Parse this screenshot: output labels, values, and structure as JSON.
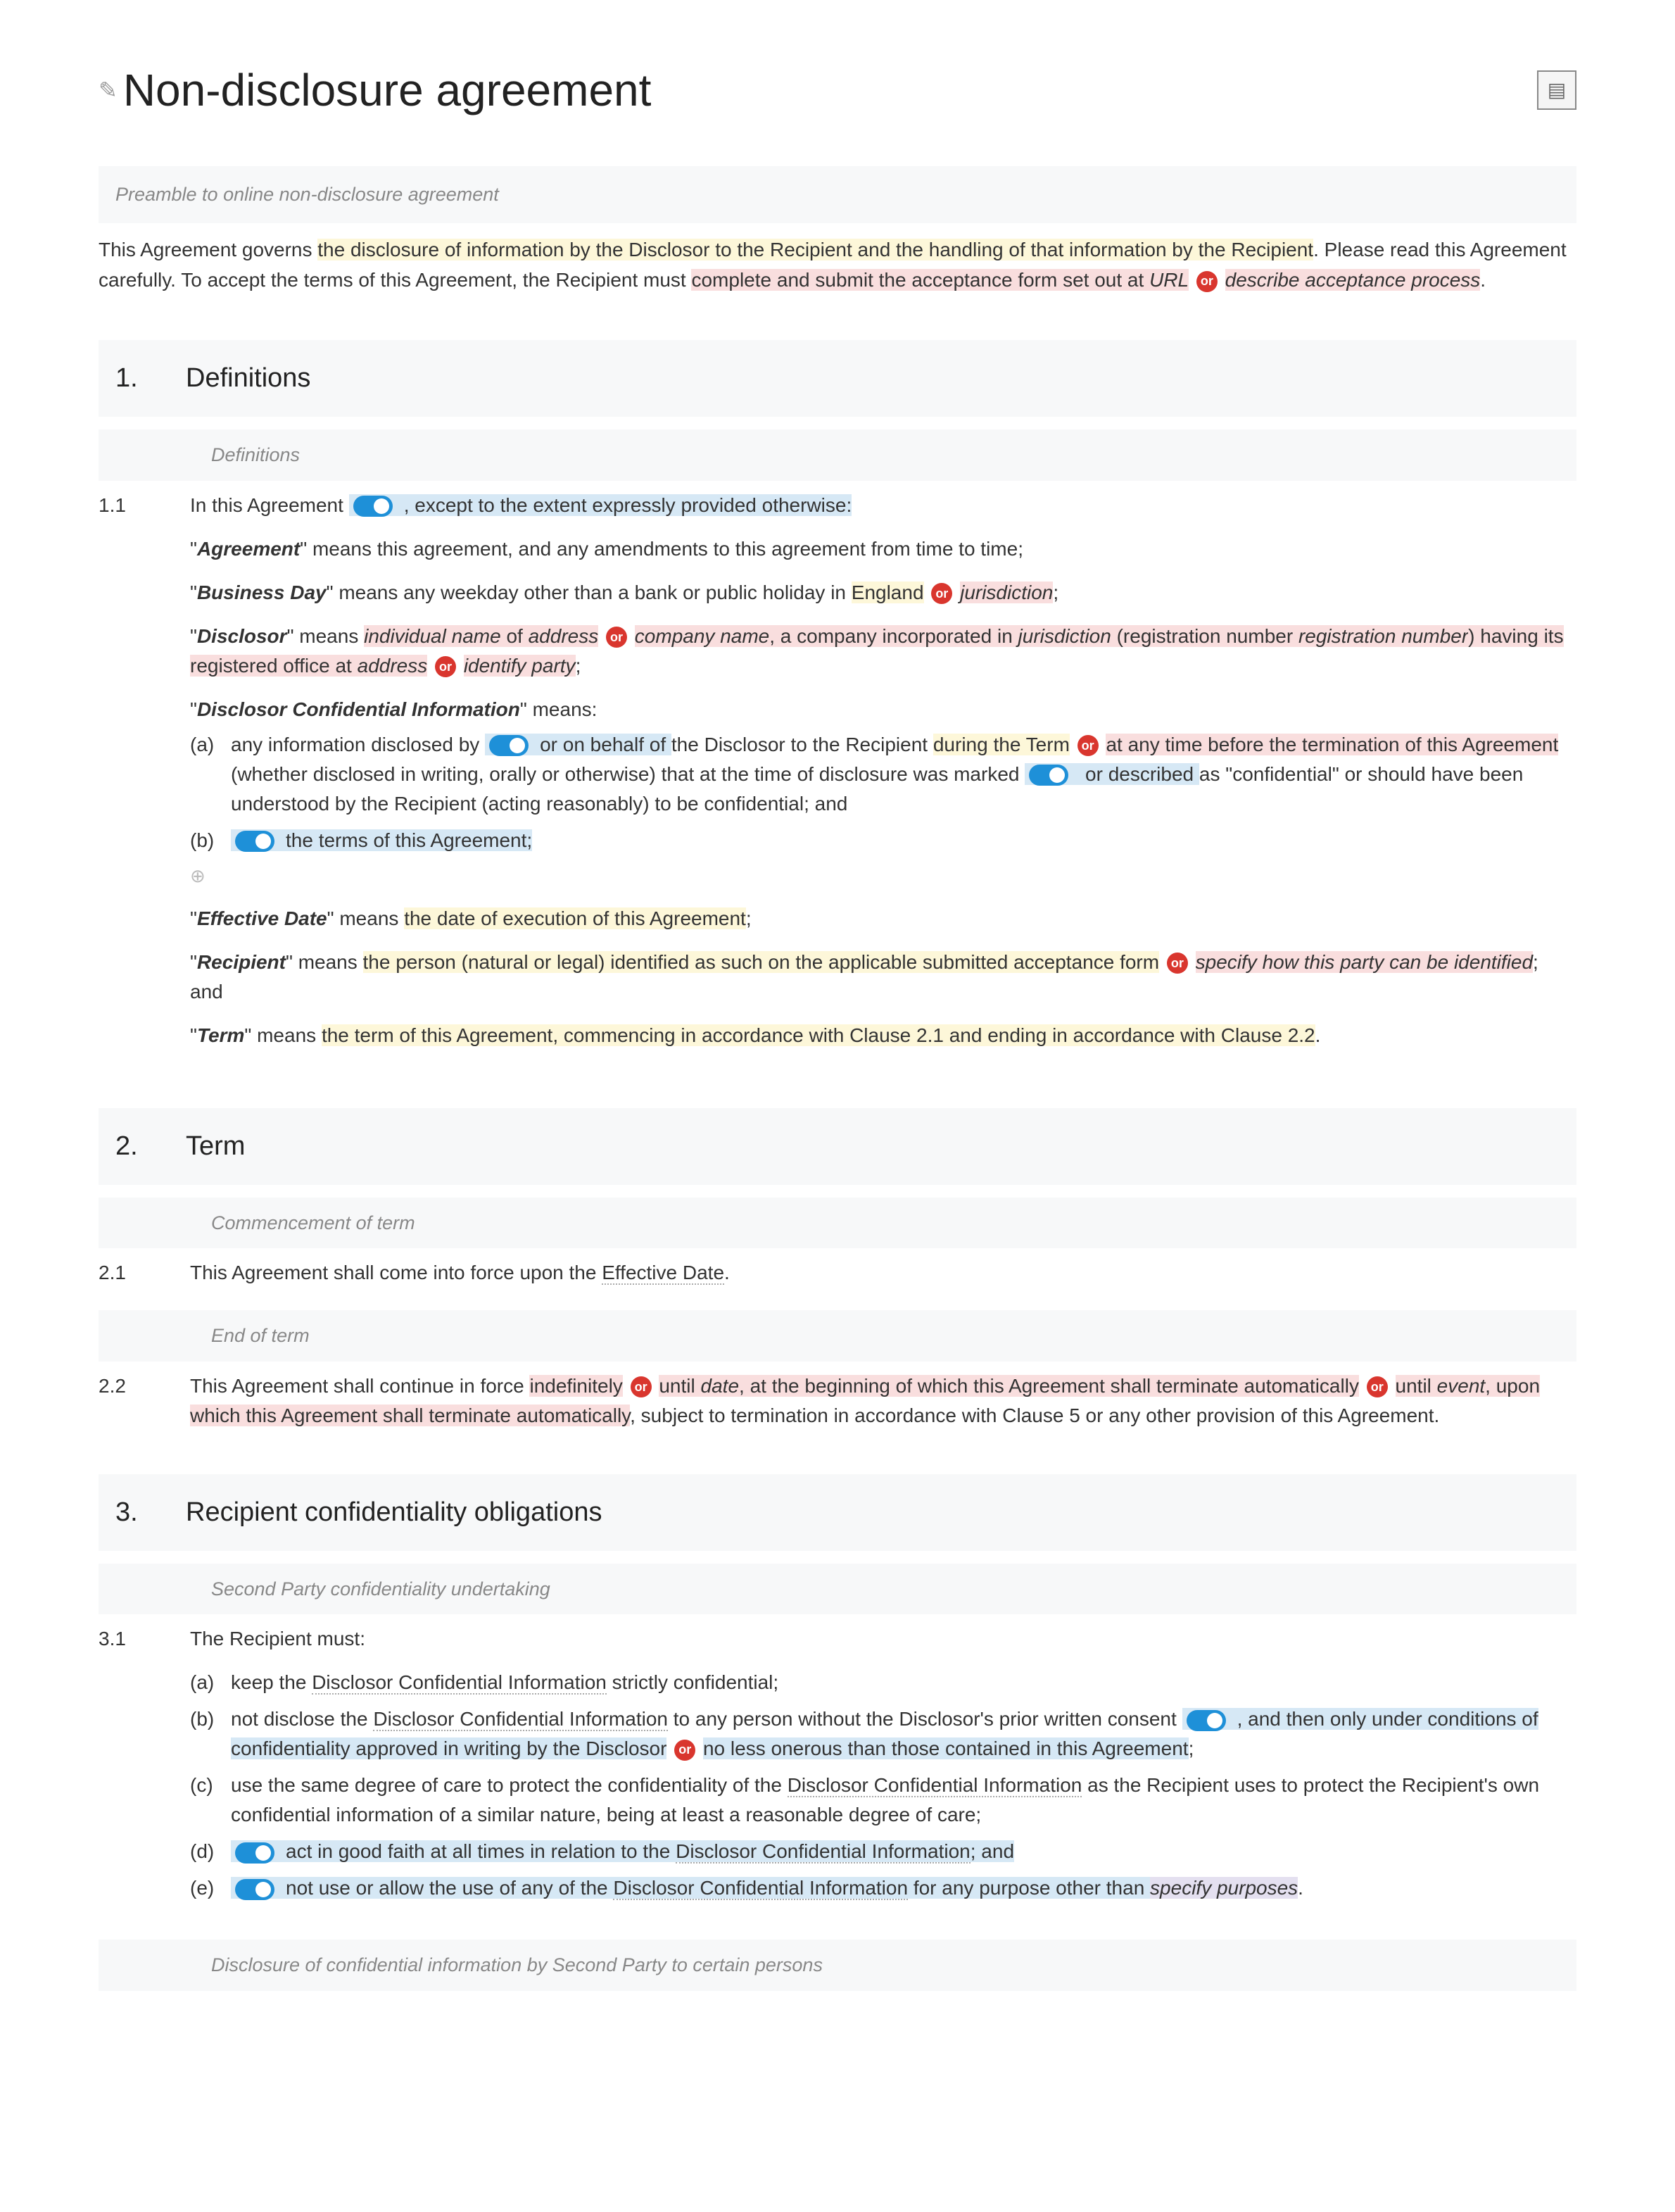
{
  "title": "Non-disclosure agreement",
  "preamble": {
    "note": "Preamble to online non-disclosure agreement",
    "p1_a": "This Agreement governs ",
    "p1_b": "the disclosure of information by the Disclosor to the Recipient and the handling of that information by the Recipient",
    "p1_c": ". Please read this Agreement carefully. To accept the terms of this Agreement, the Recipient must ",
    "p1_d": "complete and submit the acceptance form set out at ",
    "url": "URL",
    "or": "or",
    "process": "describe acceptance process",
    "p1_end": "."
  },
  "s1": {
    "num": "1.",
    "title": "Definitions",
    "note": "Definitions",
    "c1": {
      "num": "1.1",
      "intro_a": "In this Agreement",
      "intro_b": ", except to the extent expressly provided otherwise:",
      "agreement_a": "\"",
      "agreement_term": "Agreement",
      "agreement_b": "\" means this agreement, and any amendments to this agreement from time to time;",
      "bday_term": "Business Day",
      "bday_a": "\" means any weekday other than a bank or public holiday in ",
      "bday_england": "England",
      "bday_juris": "jurisdiction",
      "bday_end": ";",
      "disc_term": "Disclosor",
      "disc_a": "\" means ",
      "disc_ind": "individual name",
      "disc_of": " of ",
      "disc_addr": "address",
      "disc_comp": "company name",
      "disc_b": ", a company incorporated in ",
      "disc_juris": "jurisdiction",
      "disc_c": " (registration number ",
      "disc_reg": "registration number",
      "disc_d": ") having its registered office at ",
      "disc_addr2": "address",
      "disc_ident": "identify party",
      "disc_end": ";",
      "dci_term": "Disclosor Confidential Information",
      "dci_means": "\" means:",
      "dci_a_label": "(a)",
      "dci_a_1": "any information disclosed by ",
      "dci_a_2": "or on behalf of ",
      "dci_a_3": "the Disclosor to the Recipient ",
      "dci_a_4": "during the Term",
      "dci_a_5": "at any time before the termination of this Agreement",
      "dci_a_6": " (whether disclosed in writing, orally or otherwise) that at the time of disclosure was marked ",
      "dci_a_7": "or described ",
      "dci_a_8": "as \"confidential\" or should have been understood by the Recipient (acting reasonably) to be confidential; and",
      "dci_b_label": "(b)",
      "dci_b_1": "the terms of this Agreement;",
      "eff_term": "Effective Date",
      "eff_a": "\" means ",
      "eff_b": "the date of execution of this Agreement",
      "eff_end": ";",
      "rec_term": "Recipient",
      "rec_a": "\" means ",
      "rec_b": "the person (natural or legal) identified as such on the applicable submitted acceptance form",
      "rec_c": "specify how this party can be identified",
      "rec_end": "; and",
      "term_term": "Term",
      "term_a": "\" means ",
      "term_b": "the term of this Agreement, commencing in accordance with Clause 2.1 and ending in accordance with Clause 2.2",
      "term_end": "."
    }
  },
  "s2": {
    "num": "2.",
    "title": "Term",
    "note1": "Commencement of term",
    "c1": {
      "num": "2.1",
      "a": "This Agreement shall come into force upon the ",
      "eff": "Effective Date",
      "end": "."
    },
    "note2": "End of term",
    "c2": {
      "num": "2.2",
      "a": "This Agreement shall continue in force ",
      "indef": "indefinitely",
      "b": " until ",
      "date": "date",
      "c": ", at the beginning of which this Agreement shall terminate automatically",
      "d": " until ",
      "event": "event",
      "e": ", upon which this Agreement shall terminate automatically",
      "f": ", subject to termination in accordance with Clause 5 or any other provision of this Agreement."
    }
  },
  "s3": {
    "num": "3.",
    "title": "Recipient confidentiality obligations",
    "note1": "Second Party confidentiality undertaking",
    "c1": {
      "num": "3.1",
      "intro": "The Recipient must:",
      "a_label": "(a)",
      "a": "keep the ",
      "a_dci": "Disclosor Confidential Information",
      "a_end": " strictly confidential;",
      "b_label": "(b)",
      "b_1": "not disclose the ",
      "b_dci": "Disclosor Confidential Information",
      "b_2": " to any person without the Disclosor's prior written consent",
      "b_3": ", and then only under conditions of confidentiality approved in writing by the Disclosor",
      "b_4": "no less onerous than those contained in this Agreement",
      "b_end": ";",
      "c_label": "(c)",
      "c_1": "use the same degree of care to protect the confidentiality of the ",
      "c_dci": "Disclosor Confidential Information",
      "c_2": " as the Recipient uses to protect the Recipient's own confidential information of a similar nature, being at least a reasonable degree of care;",
      "d_label": "(d)",
      "d_1": "act in good faith at all times in relation to the ",
      "d_dci": "Disclosor Confidential Information",
      "d_end": "; and",
      "e_label": "(e)",
      "e_1": "not use or allow the use of any of the ",
      "e_dci": "Disclosor Confidential Information",
      "e_2": " for any purpose other than ",
      "e_purp": "specify purposes",
      "e_end": "."
    },
    "note2": "Disclosure of confidential information by Second Party to certain persons"
  }
}
